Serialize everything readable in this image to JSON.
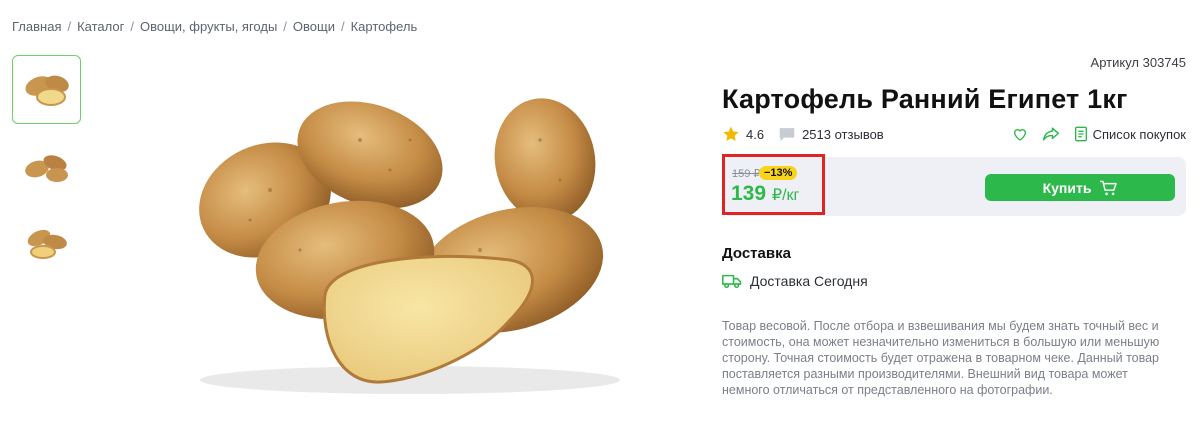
{
  "breadcrumb": {
    "items": [
      "Главная",
      "Каталог",
      "Овощи, фрукты, ягоды",
      "Овощи",
      "Картофель"
    ],
    "separator": "/"
  },
  "product": {
    "article": "Артикул 303745",
    "title": "Картофель Ранний Египет 1кг",
    "rating": "4.6",
    "reviews": "2513 отзывов",
    "shopping_list_label": "Список покупок",
    "old_price": "159 ₽",
    "discount": "−13%",
    "price_value": "139",
    "price_unit": "₽/кг",
    "buy_label": "Купить"
  },
  "delivery": {
    "heading": "Доставка",
    "option": "Доставка Сегодня"
  },
  "description": "Товар весовой. После отбора и взвешивания мы будем знать точный вес и стоимость, она может незначительно измениться в большую или меньшую сторону. Точная стоимость будет отражена в товарном чеке. Данный товар поставляется разными производителями. Внешний вид товара может немного отличаться от представленного на фотографии.",
  "colors": {
    "accent_green": "#2db84b",
    "discount_yellow": "#f8d41a",
    "highlight_red": "#e02424",
    "panel_bg": "#eef0f5"
  },
  "icons": {
    "rating": "star-icon",
    "reviews": "comment-icon",
    "favorite": "heart-icon",
    "share": "share-icon",
    "list": "list-icon",
    "buy": "cart-icon",
    "delivery": "truck-icon"
  }
}
